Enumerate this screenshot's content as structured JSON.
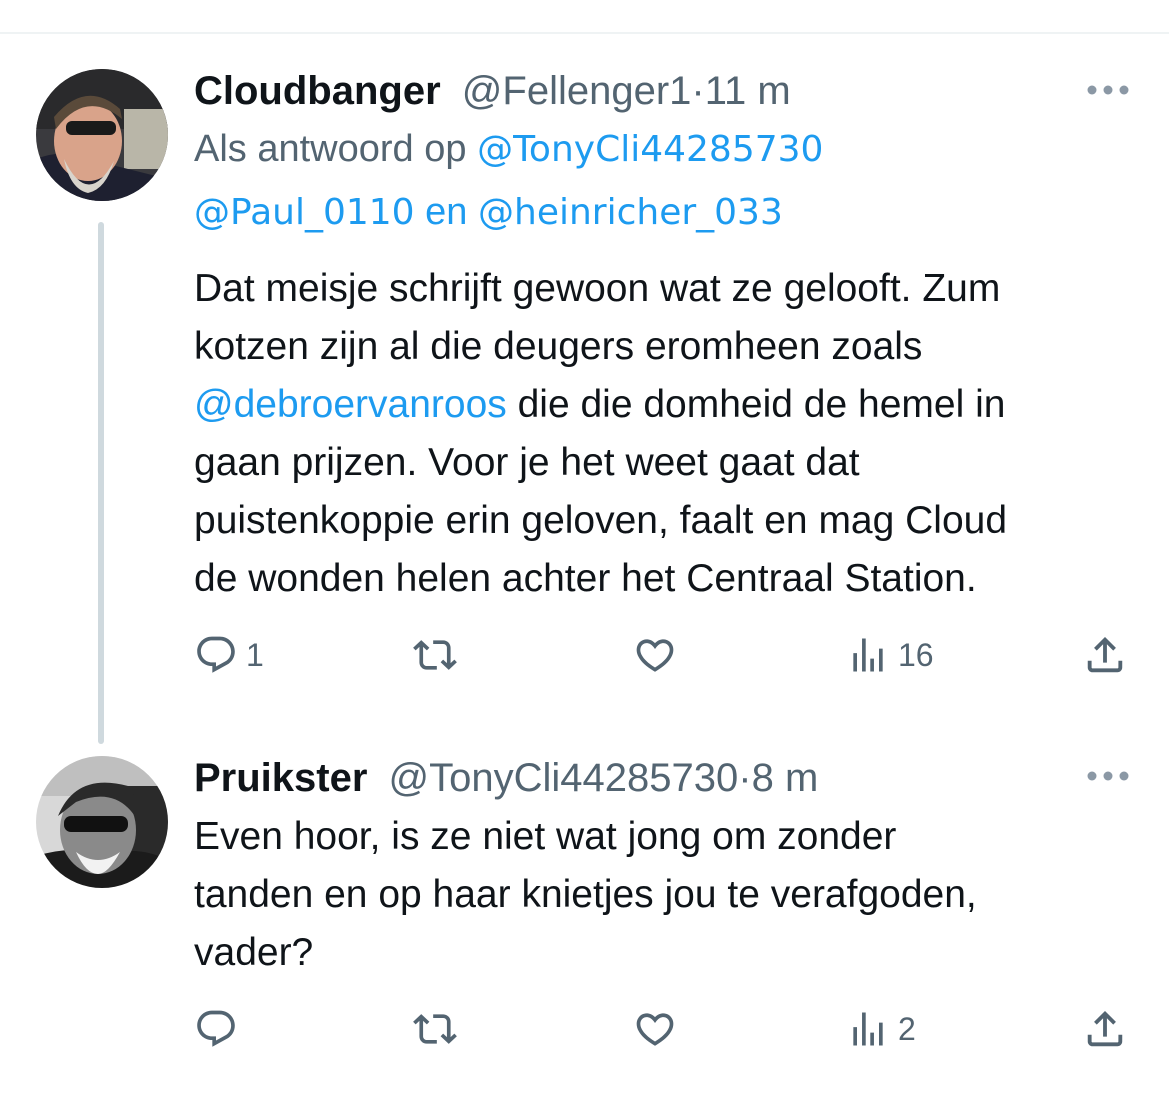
{
  "tweets": [
    {
      "display_name": "Cloudbanger",
      "handle": "@Fellenger1",
      "separator": "·",
      "time": "11 m",
      "reply_prefix": "Als antwoord op",
      "reply_mention_1": "@TonyCli44285730",
      "reply_mention_2": "@Paul_0110",
      "reply_conjunction": "en",
      "reply_mention_3": "@heinricher_033",
      "text_line_1": "Dat meisje schrijft gewoon wat ze gelooft. Zum",
      "text_line_2": "kotzen zijn al die deugers eromheen zoals",
      "text_line_3_mention": "@debroervanroos",
      "text_line_3_rest": " die die domheid de hemel in",
      "text_line_4": "gaan prijzen. Voor je het weet gaat dat",
      "text_line_5": "puistenkoppie erin geloven, faalt en mag Cloud",
      "text_line_6": "de wonden helen achter het Centraal Station.",
      "reply_count": "1",
      "retweet_count": "",
      "like_count": "",
      "view_count": "16",
      "more_icon": "more-dots-icon"
    },
    {
      "display_name": "Pruikster",
      "handle": "@TonyCli44285730",
      "separator": "·",
      "time": "8 m",
      "text_line_1": "Even hoor, is ze niet wat jong om zonder",
      "text_line_2": "tanden en op haar knietjes jou te verafgoden,",
      "text_line_3": "vader?",
      "reply_count": "",
      "retweet_count": "",
      "like_count": "",
      "view_count": "2",
      "more_icon": "more-dots-icon"
    }
  ],
  "icons": {
    "reply": "reply-icon",
    "retweet": "retweet-icon",
    "like": "like-icon",
    "views": "views-icon",
    "share": "share-icon"
  },
  "colors": {
    "link": "#1d9bf0",
    "secondary_text": "#536471",
    "primary_text": "#0f1419",
    "thread_line": "#cfd9de"
  }
}
